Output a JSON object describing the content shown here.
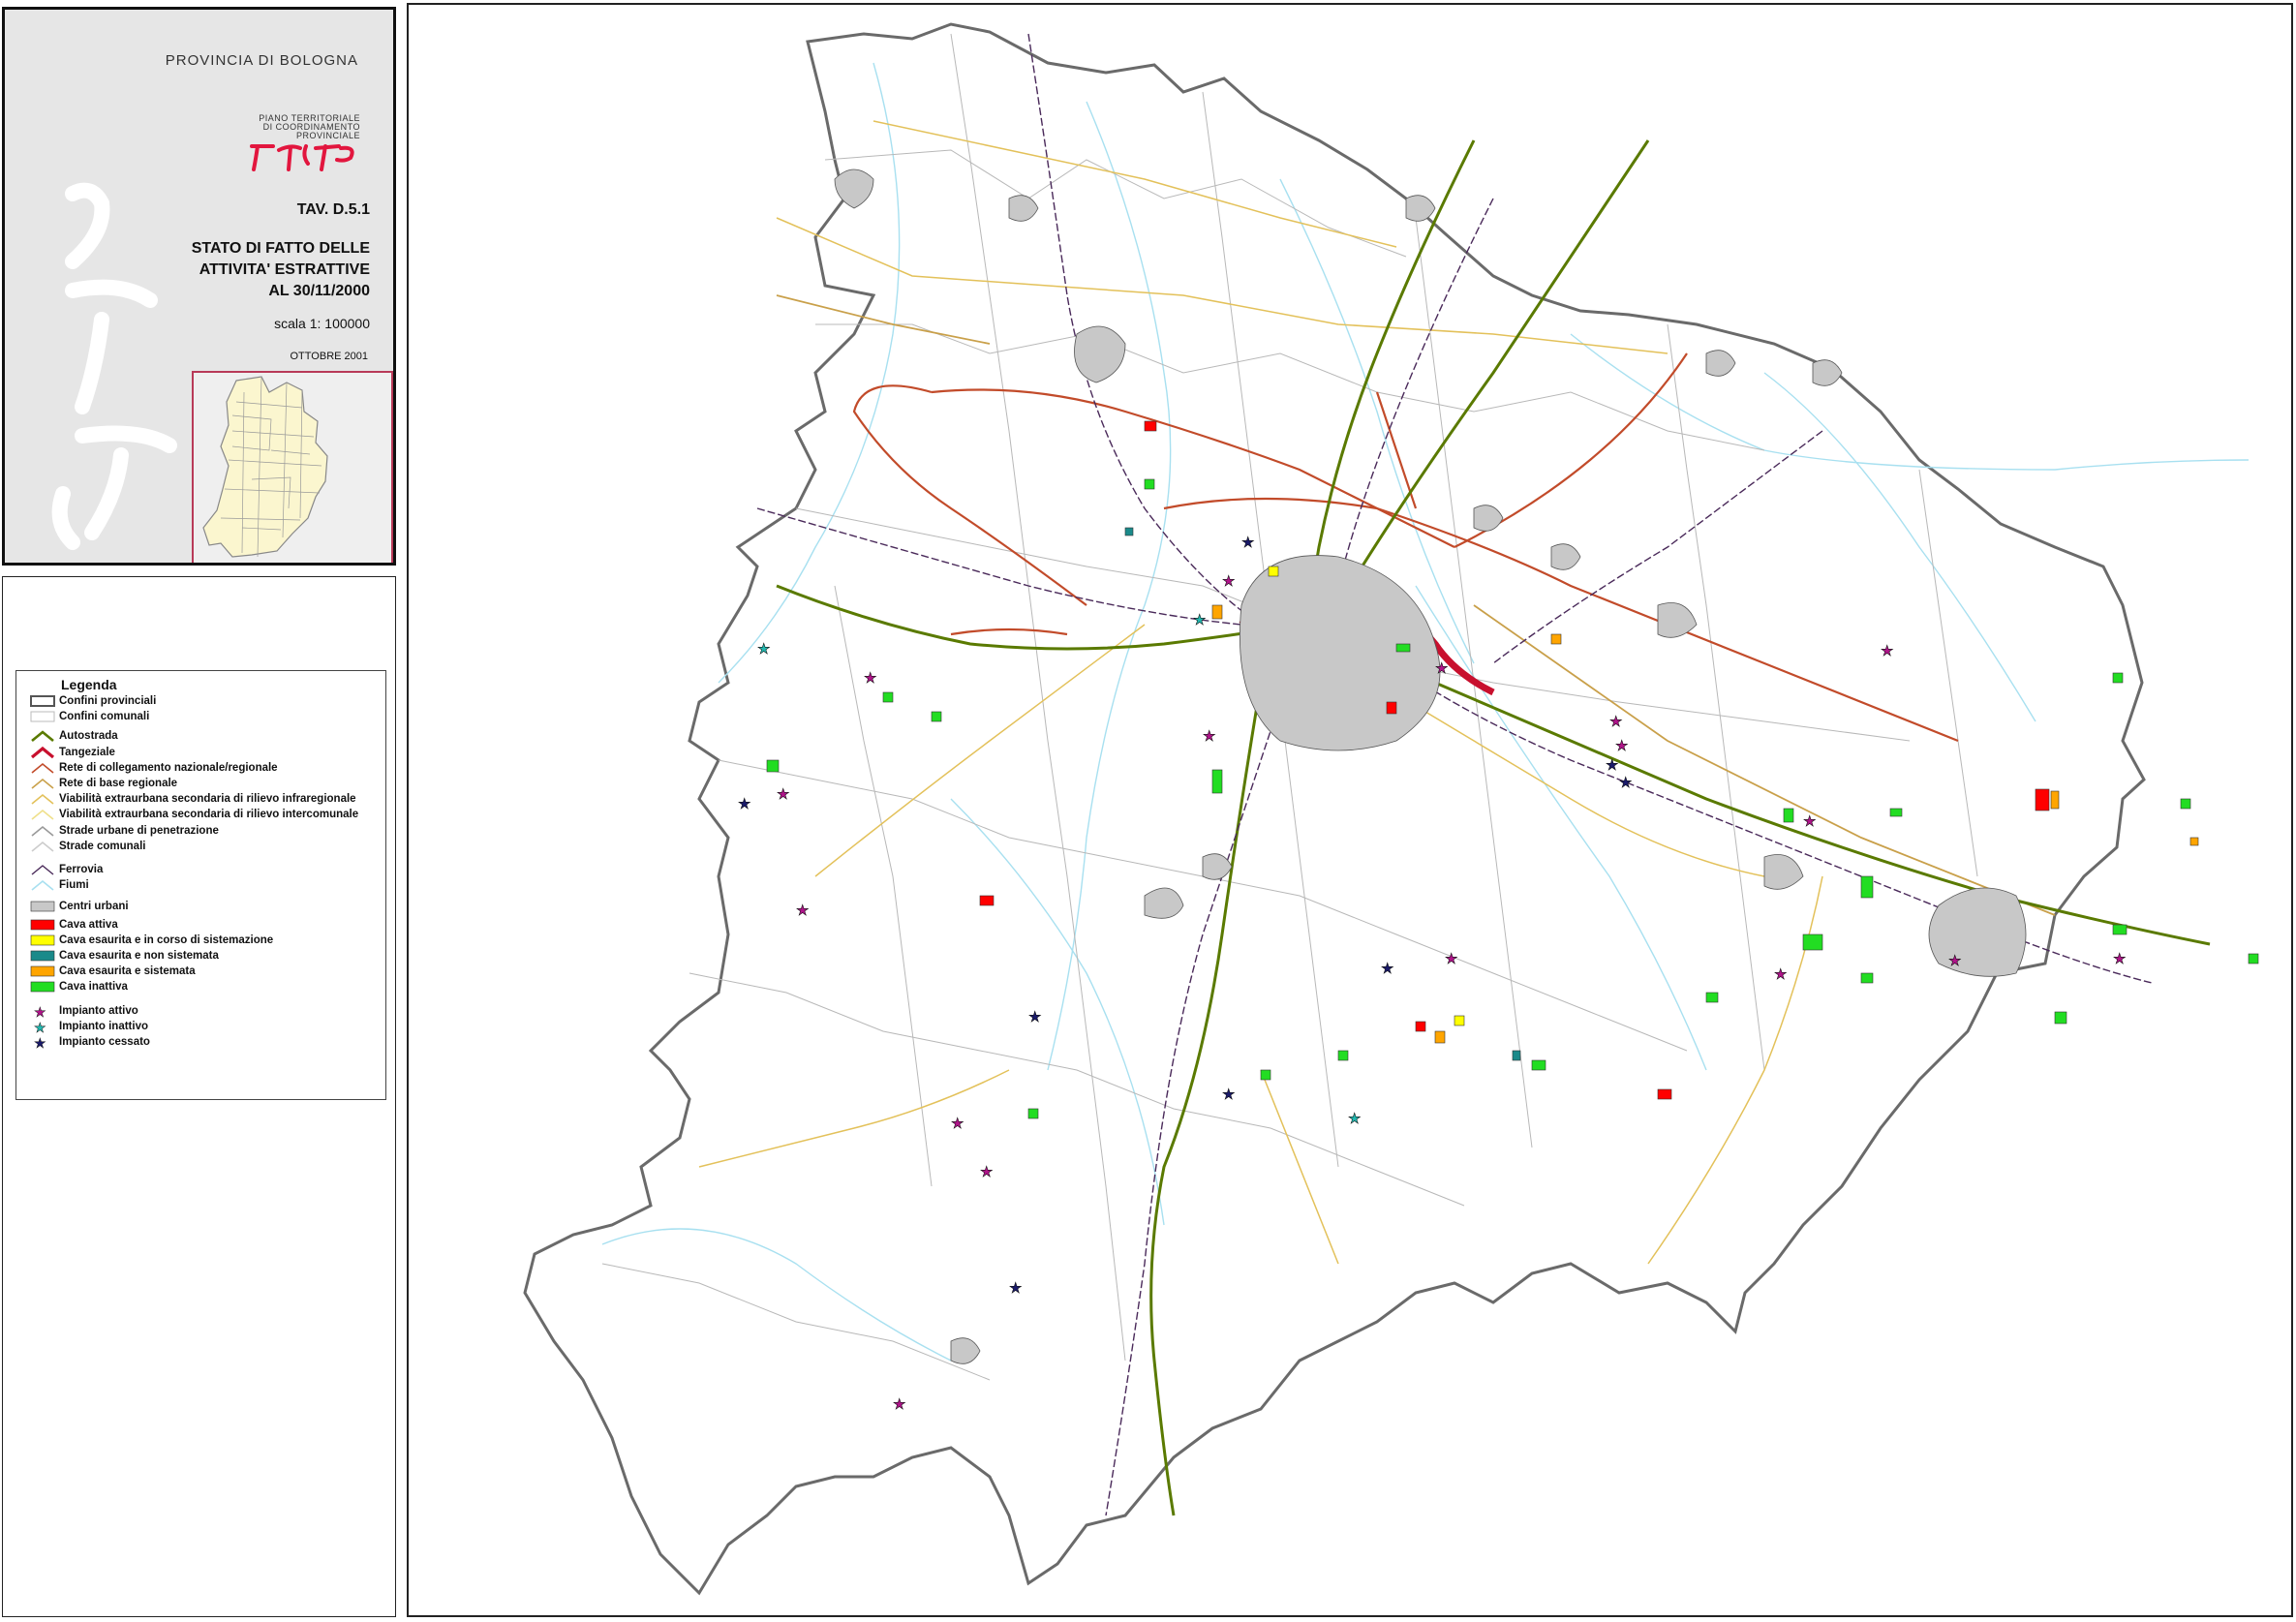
{
  "title_panel": {
    "province": "PROVINCIA DI BOLOGNA",
    "plan_lines": [
      "PIANO TERRITORIALE",
      "DI COORDINAMENTO",
      "PROVINCIALE"
    ],
    "sheet": "TAV. D.5.1",
    "subtitle_lines": [
      "STATO DI FATTO DELLE",
      "ATTIVITA' ESTRATTIVE",
      "AL 30/11/2000"
    ],
    "scale": "scala 1: 100000",
    "date": "OTTOBRE 2001",
    "colors": {
      "logo_red": "#e2163e",
      "inset_border": "#b83a58",
      "inset_fill": "#fbf6cf"
    }
  },
  "legend": {
    "title": "Legenda",
    "items": [
      {
        "label": "Confini provinciali",
        "symbol": "province-border-icon",
        "bold": true
      },
      {
        "label": "Confini comunali",
        "symbol": "municipal-border-icon",
        "bold": true
      },
      {
        "label": "Autostrada",
        "symbol": "motorway-line-icon",
        "color": "#5a7a00",
        "bold": true
      },
      {
        "label": "Tangeziale",
        "symbol": "ring-road-line-icon",
        "color": "#c8102e",
        "bold": true
      },
      {
        "label": "Rete di collegamento nazionale/regionale",
        "symbol": "national-road-line-icon",
        "color": "#c24b2a",
        "bold": true
      },
      {
        "label": "Rete di base regionale",
        "symbol": "regional-road-line-icon",
        "color": "#c9a04a",
        "bold": true
      },
      {
        "label": "Viabilità extraurbana secondaria di rilievo infraregionale",
        "symbol": "secondary-infra-line-icon",
        "color": "#e3c15a",
        "bold": true
      },
      {
        "label": "Viabilità extraurbana secondaria di rilievo intercomunale",
        "symbol": "secondary-inter-line-icon",
        "color": "#efe08a",
        "bold": true
      },
      {
        "label": "Strade urbane di penetrazione",
        "symbol": "urban-road-line-icon",
        "color": "#999999",
        "bold": true
      },
      {
        "label": "Strade comunali",
        "symbol": "municipal-road-line-icon",
        "color": "#cccccc",
        "bold": true
      },
      {
        "label": "Ferrovia",
        "symbol": "railway-line-icon",
        "color": "#4a2a5a",
        "bold": true
      },
      {
        "label": "Fiumi",
        "symbol": "river-line-icon",
        "color": "#a8e0f0",
        "bold": true
      },
      {
        "label": "Centri urbani",
        "symbol": "urban-center-icon",
        "color": "#c8c8c8",
        "bold": true
      },
      {
        "label": "Cava attiva",
        "symbol": "quarry-active-icon",
        "color": "#ff0000",
        "bold": true
      },
      {
        "label": "Cava esaurita e in corso di sistemazione",
        "symbol": "quarry-restoring-icon",
        "color": "#ffff00",
        "bold": true
      },
      {
        "label": "Cava esaurita e non sistemata",
        "symbol": "quarry-unrestored-icon",
        "color": "#1a8a8a",
        "bold": true
      },
      {
        "label": "Cava esaurita e sistemata",
        "symbol": "quarry-restored-icon",
        "color": "#ffa500",
        "bold": true
      },
      {
        "label": "Cava inattiva",
        "symbol": "quarry-inactive-icon",
        "color": "#22dd22",
        "bold": true
      },
      {
        "label": "Impianto attivo",
        "symbol": "plant-active-star-icon",
        "color": "#b0148a",
        "bold": true
      },
      {
        "label": "Impianto inattivo",
        "symbol": "plant-inactive-star-icon",
        "color": "#22b8b0",
        "bold": true
      },
      {
        "label": "Impianto cessato",
        "symbol": "plant-ceased-star-icon",
        "color": "#1a1a6a",
        "bold": true
      }
    ]
  }
}
